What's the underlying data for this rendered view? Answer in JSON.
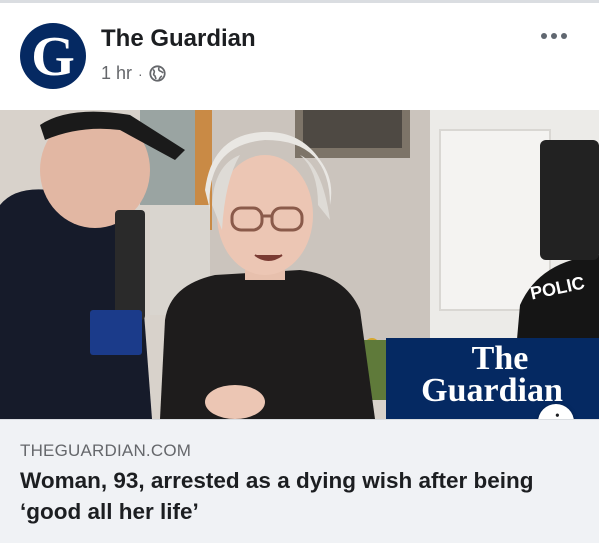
{
  "post": {
    "page_name": "The Guardian",
    "avatar_letter": "G",
    "timestamp": "1 hr",
    "separator": "·",
    "audience_icon": "globe-icon",
    "more_icon": "more-options-icon"
  },
  "photo": {
    "description_icon": "photo",
    "watermark_line1": "The",
    "watermark_line2": "Guardian",
    "police_text": "POLIC",
    "badge_text": "POLICE OFFICER"
  },
  "link_preview": {
    "domain": "THEGUARDIAN.COM",
    "headline": "Woman, 93, arrested as a dying wish after being ‘good all her life’",
    "info_label": "i"
  },
  "colors": {
    "brand_navy": "#052962",
    "preview_bg": "#f0f2f5",
    "secondary_text": "#65676b"
  }
}
